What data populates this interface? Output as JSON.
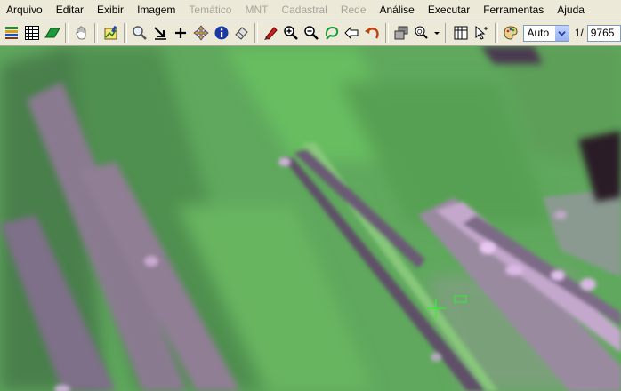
{
  "menu": [
    {
      "label": "Arquivo",
      "enabled": true
    },
    {
      "label": "Editar",
      "enabled": true
    },
    {
      "label": "Exibir",
      "enabled": true
    },
    {
      "label": "Imagem",
      "enabled": true
    },
    {
      "label": "Temático",
      "enabled": false
    },
    {
      "label": "MNT",
      "enabled": false
    },
    {
      "label": "Cadastral",
      "enabled": false
    },
    {
      "label": "Rede",
      "enabled": false
    },
    {
      "label": "Análise",
      "enabled": true
    },
    {
      "label": "Executar",
      "enabled": true
    },
    {
      "label": "Ferramentas",
      "enabled": true
    },
    {
      "label": "Ajuda",
      "enabled": true
    }
  ],
  "toolbar": {
    "zoom_select_value": "Auto",
    "scale_prefix": "1/",
    "scale_value": "9765"
  },
  "colors": {
    "vegetation": "#5db35a",
    "vegetation_dark": "#4a8a4a",
    "soil_purple": "#8a7a90",
    "soil_light": "#c8a8d0",
    "cursor": "#33ee33"
  }
}
